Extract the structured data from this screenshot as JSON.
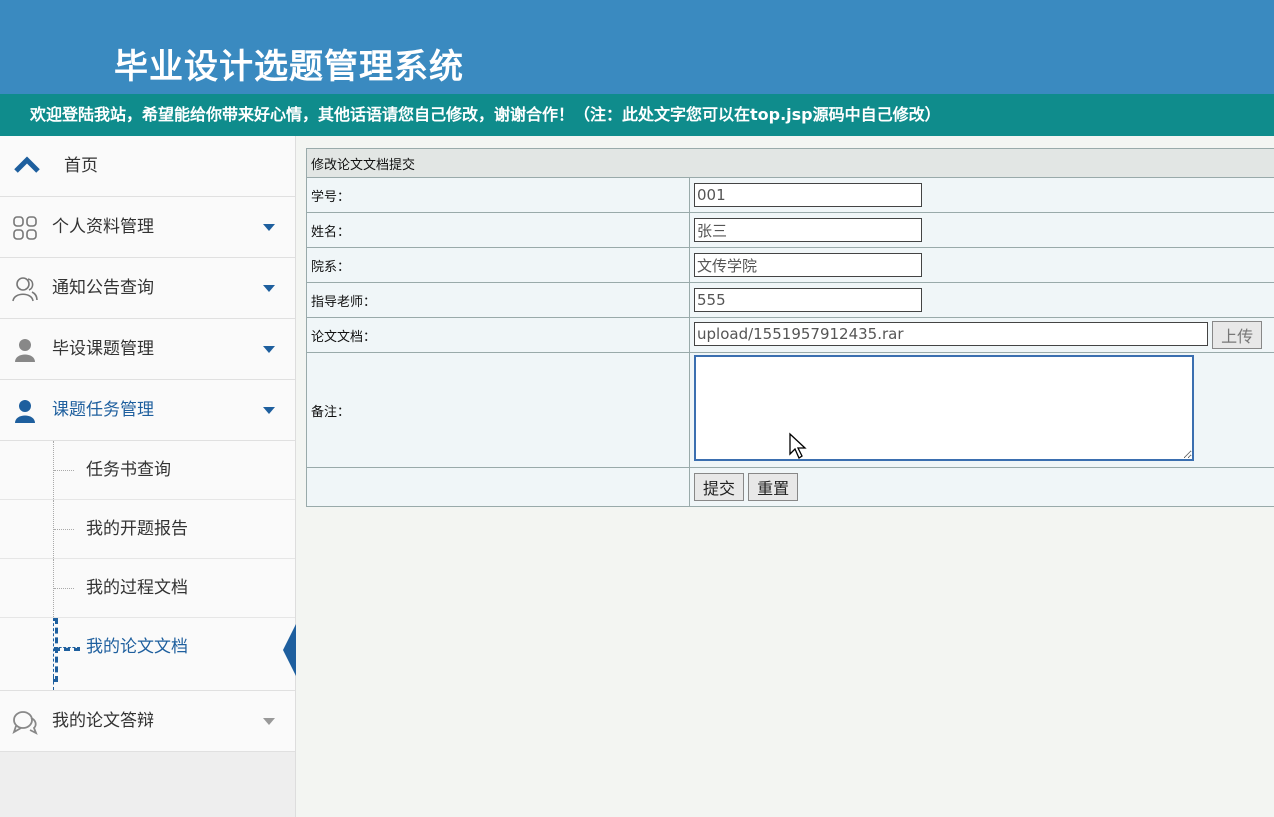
{
  "header": {
    "title": "毕业设计选题管理系统",
    "welcome": "欢迎登陆我站，希望能给你带来好心情，其他话语请您自己修改，谢谢合作！（注：此处文字您可以在top.jsp源码中自己修改）"
  },
  "sidebar": {
    "home": {
      "label": "首页",
      "icon": "home-icon"
    },
    "items": [
      {
        "label": "个人资料管理",
        "icon": "grid-icon"
      },
      {
        "label": "通知公告查询",
        "icon": "users-icon"
      },
      {
        "label": "毕设课题管理",
        "icon": "user-icon"
      },
      {
        "label": "课题任务管理",
        "icon": "user-icon",
        "active": true
      }
    ],
    "submenu": [
      {
        "label": "任务书查询"
      },
      {
        "label": "我的开题报告"
      },
      {
        "label": "我的过程文档"
      },
      {
        "label": "我的论文文档",
        "current": true
      }
    ],
    "last_item": {
      "label": "我的论文答辩",
      "icon": "chat-icon"
    },
    "colors": {
      "active": "#1e5f9e",
      "header": "#3a8ac0",
      "bar": "#0f8c8c"
    }
  },
  "form": {
    "title": "修改论文文档提交",
    "fields": {
      "student_id": {
        "label": "学号：",
        "value": "001"
      },
      "name": {
        "label": "姓名：",
        "value": "张三"
      },
      "department": {
        "label": "院系：",
        "value": "文传学院"
      },
      "advisor": {
        "label": "指导老师：",
        "value": "555"
      },
      "document": {
        "label": "论文文档：",
        "value": "upload/1551957912435.rar",
        "upload_label": "上传"
      },
      "remark": {
        "label": "备注：",
        "value": ""
      }
    },
    "submit_label": "提交",
    "reset_label": "重置"
  }
}
